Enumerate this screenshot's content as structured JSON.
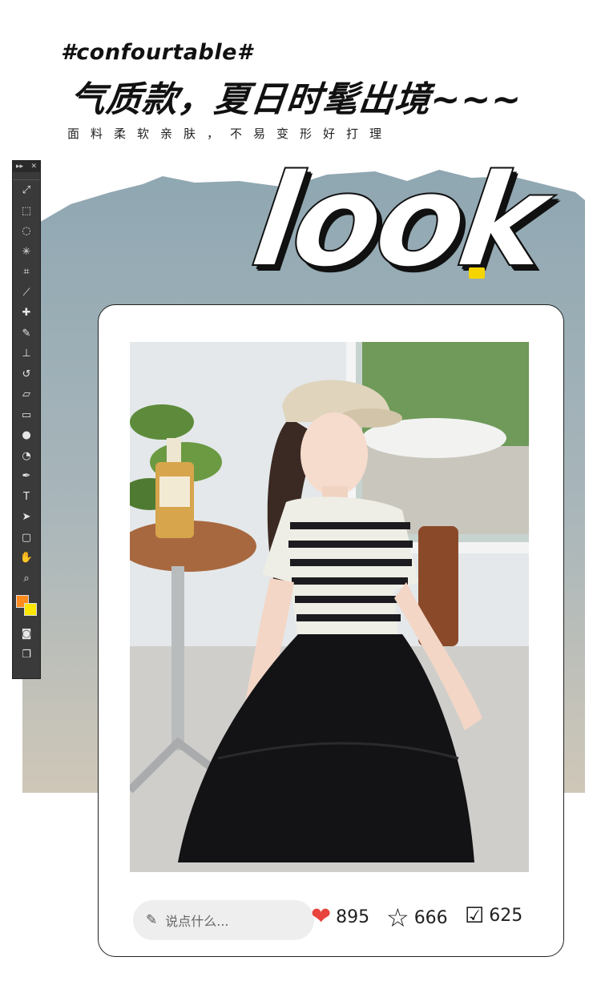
{
  "header": {
    "hashtag": "#confourtable#",
    "headline": "气质款，夏日时髦出境~~~",
    "subline": "面料柔软亲肤，不易变形好打理"
  },
  "hero": {
    "word": "look"
  },
  "toolbar": {
    "collapse_glyph": "▸▸",
    "close_glyph": "✕",
    "tools": [
      {
        "name": "move-tool-icon",
        "glyph": "⤢"
      },
      {
        "name": "marquee-tool-icon",
        "glyph": "⬚"
      },
      {
        "name": "lasso-tool-icon",
        "glyph": "◌"
      },
      {
        "name": "magic-wand-tool-icon",
        "glyph": "✳"
      },
      {
        "name": "crop-tool-icon",
        "glyph": "⌗"
      },
      {
        "name": "eyedropper-tool-icon",
        "glyph": "⟋"
      },
      {
        "name": "healing-tool-icon",
        "glyph": "✚"
      },
      {
        "name": "brush-tool-icon",
        "glyph": "✎"
      },
      {
        "name": "stamp-tool-icon",
        "glyph": "⊥"
      },
      {
        "name": "history-brush-tool-icon",
        "glyph": "↺"
      },
      {
        "name": "eraser-tool-icon",
        "glyph": "▱"
      },
      {
        "name": "gradient-tool-icon",
        "glyph": "▭"
      },
      {
        "name": "blur-tool-icon",
        "glyph": "●"
      },
      {
        "name": "dodge-tool-icon",
        "glyph": "◔"
      },
      {
        "name": "pen-tool-icon",
        "glyph": "✒"
      },
      {
        "name": "type-tool-icon",
        "glyph": "T"
      },
      {
        "name": "path-selection-tool-icon",
        "glyph": "➤"
      },
      {
        "name": "shape-tool-icon",
        "glyph": "▢"
      },
      {
        "name": "hand-tool-icon",
        "glyph": "✋"
      },
      {
        "name": "zoom-tool-icon",
        "glyph": "⌕"
      }
    ],
    "colors": {
      "foreground": "#ff8a1e",
      "background": "#ffe600"
    }
  },
  "post": {
    "comment_placeholder": "说点什么...",
    "comment_icon": "pencil-icon",
    "likes": "895",
    "favorites": "666",
    "checks": "625"
  },
  "colors": {
    "backdrop_top": "#93a9b3",
    "backdrop_bottom": "#c9c3b6",
    "heart": "#e8433c"
  }
}
